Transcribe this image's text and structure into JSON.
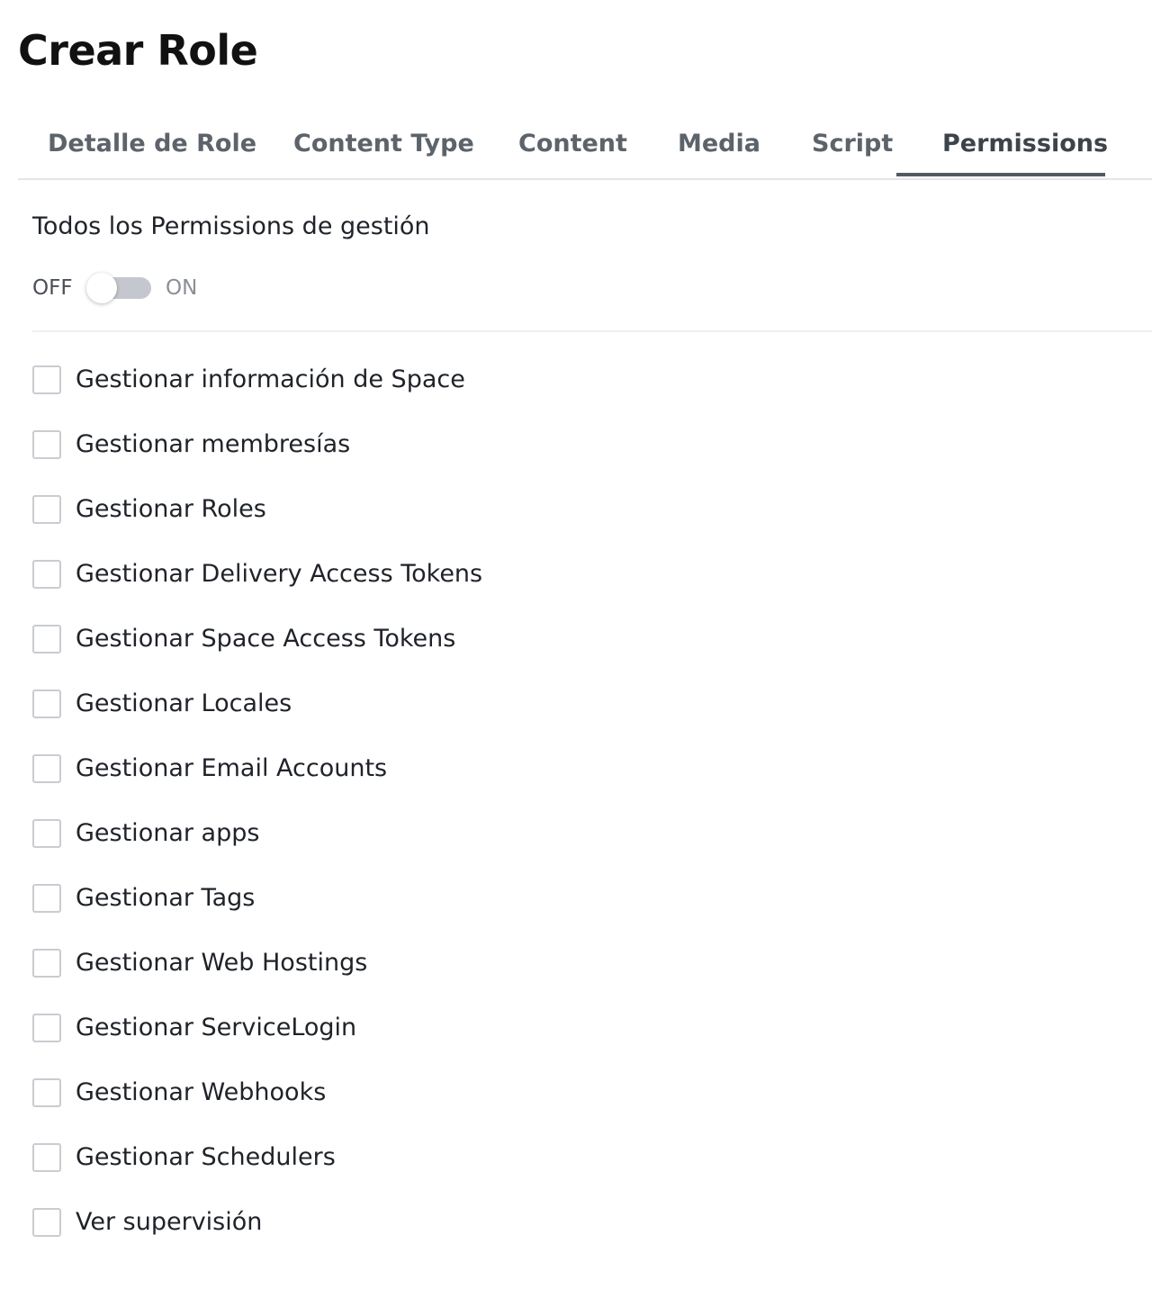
{
  "page": {
    "title": "Crear Role"
  },
  "tabs": [
    {
      "label": "Detalle de Role",
      "active": false
    },
    {
      "label": "Content Type",
      "active": false
    },
    {
      "label": "Content",
      "active": false
    },
    {
      "label": "Media",
      "active": false
    },
    {
      "label": "Script",
      "active": false
    },
    {
      "label": "Permissions",
      "active": true
    }
  ],
  "permissions_section": {
    "heading": "Todos los Permissions de gestión",
    "toggle": {
      "off_label": "OFF",
      "on_label": "ON",
      "state": "off"
    },
    "items": [
      {
        "label": "Gestionar información de Space",
        "checked": false
      },
      {
        "label": "Gestionar membresías",
        "checked": false
      },
      {
        "label": "Gestionar Roles",
        "checked": false
      },
      {
        "label": "Gestionar Delivery Access Tokens",
        "checked": false
      },
      {
        "label": "Gestionar Space Access Tokens",
        "checked": false
      },
      {
        "label": "Gestionar Locales",
        "checked": false
      },
      {
        "label": "Gestionar Email Accounts",
        "checked": false
      },
      {
        "label": "Gestionar apps",
        "checked": false
      },
      {
        "label": "Gestionar Tags",
        "checked": false
      },
      {
        "label": "Gestionar Web Hostings",
        "checked": false
      },
      {
        "label": "Gestionar ServiceLogin",
        "checked": false
      },
      {
        "label": "Gestionar Webhooks",
        "checked": false
      },
      {
        "label": "Gestionar Schedulers",
        "checked": false
      },
      {
        "label": "Ver supervisión",
        "checked": false
      }
    ]
  },
  "colors": {
    "text": "#1f2329",
    "tab_text": "#5d636b",
    "tab_active_underline": "#545a61",
    "switch_track_off": "#c4c8ce",
    "checkbox_border": "#c9ccd1"
  }
}
